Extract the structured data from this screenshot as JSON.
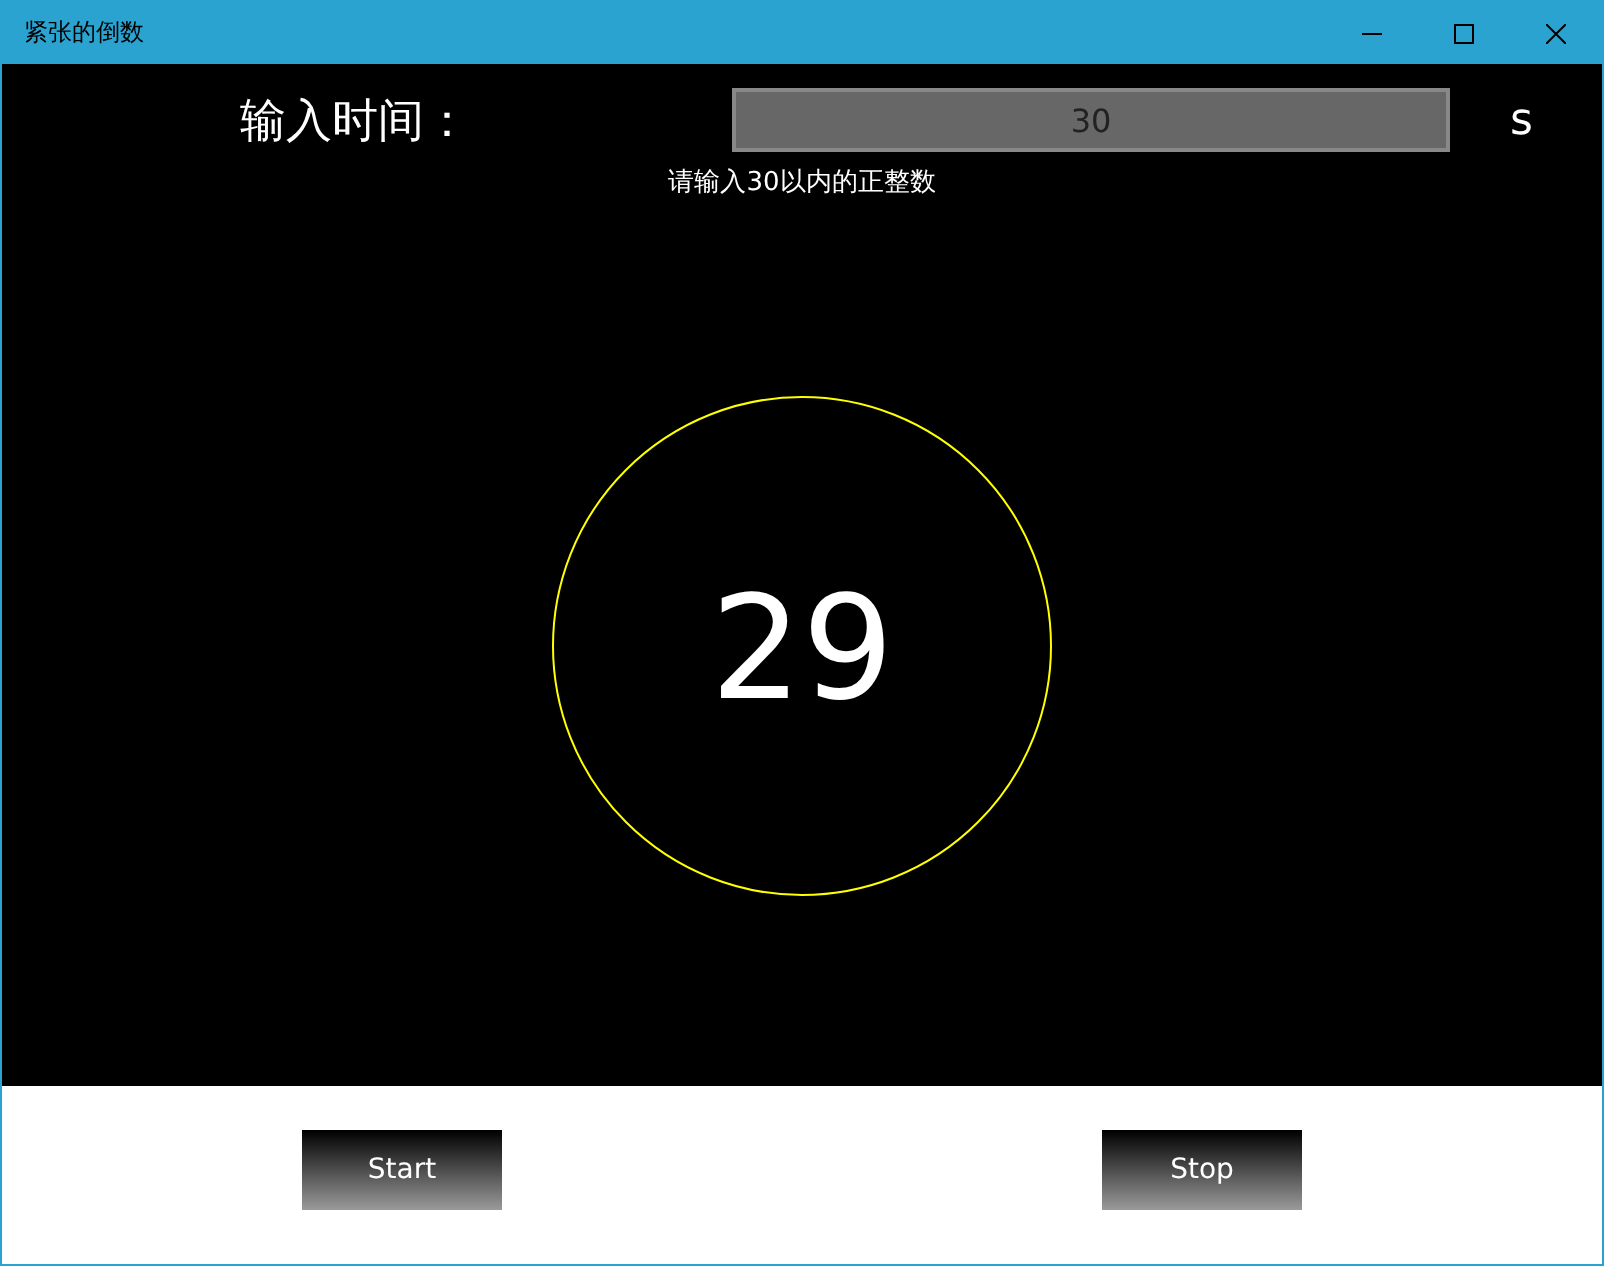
{
  "window": {
    "title": "紧张的倒数"
  },
  "time_input": {
    "label": "输入时间：",
    "value": "30",
    "unit": "s",
    "hint": "请输入30以内的正整数"
  },
  "countdown": {
    "value": "29"
  },
  "buttons": [
    "Start",
    "Stop"
  ]
}
